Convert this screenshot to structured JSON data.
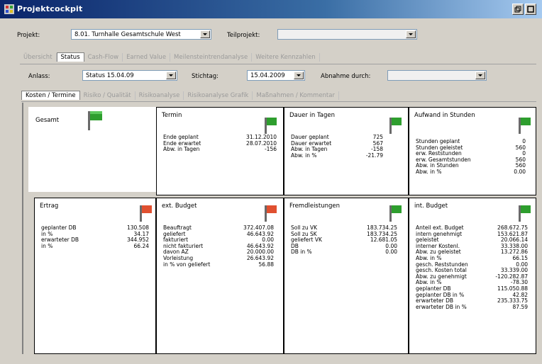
{
  "window": {
    "title": "Projektcockpit"
  },
  "header": {
    "projekt_label": "Projekt:",
    "projekt_value": "8.01. Turnhalle Gesamtschule West",
    "teilprojekt_label": "Teilprojekt:",
    "teilprojekt_value": ""
  },
  "main_tabs": [
    "Übersicht",
    "Status",
    "Cash-Flow",
    "Earned Value",
    "Meilensteintrendanalyse",
    "Weitere Kennzahlen"
  ],
  "filters": {
    "anlass_label": "Anlass:",
    "anlass_value": "Status 15.04.09",
    "stichtag_label": "Stichtag:",
    "stichtag_value": "15.04.2009",
    "abnahme_label": "Abnahme durch:",
    "abnahme_value": ""
  },
  "sub_tabs": [
    "Kosten / Termine",
    "Risiko / Qualität",
    "Risikoanalyse",
    "Risikoanalyse Grafik",
    "Maßnahmen / Kommentar"
  ],
  "colors": {
    "flag_green": "#2e9e2e",
    "flag_red": "#e05030",
    "titlebar": "#0a246a"
  },
  "cards": {
    "gesamt": {
      "title": "Gesamt",
      "flag": "green"
    },
    "termin": {
      "title": "Termin",
      "flag": "green",
      "rows": [
        {
          "label": "Ende geplant",
          "value": "31.12.2010"
        },
        {
          "label": "Ende erwartet",
          "value": "28.07.2010"
        },
        {
          "label": "Abw. in Tagen",
          "value": "-156"
        }
      ]
    },
    "dauer": {
      "title": "Dauer in Tagen",
      "flag": "green",
      "rows": [
        {
          "label": "Dauer geplant",
          "value": "725"
        },
        {
          "label": "Dauer erwartet",
          "value": "567"
        },
        {
          "label": "Abw. in Tagen",
          "value": "-158"
        },
        {
          "label": "Abw. in %",
          "value": "-21.79"
        }
      ]
    },
    "aufwand": {
      "title": "Aufwand in Stunden",
      "flag": "green",
      "rows": [
        {
          "label": "Stunden geplant",
          "value": "0"
        },
        {
          "label": "Stunden geleistet",
          "value": "560"
        },
        {
          "label": "erw. Reststunden",
          "value": "0"
        },
        {
          "label": "erw. Gesamtstunden",
          "value": "560"
        },
        {
          "label": "Abw. in Stunden",
          "value": "560"
        },
        {
          "label": "Abw. in %",
          "value": "0.00"
        }
      ]
    },
    "ertrag": {
      "title": "Ertrag",
      "flag": "red",
      "rows": [
        {
          "label": "geplanter DB",
          "value": "130.508"
        },
        {
          "label": "in %",
          "value": "34.17"
        },
        {
          "label": "erwarteter DB",
          "value": "344.952"
        },
        {
          "label": "in %",
          "value": "66.24"
        }
      ]
    },
    "extbudget": {
      "title": "ext. Budget",
      "flag": "red",
      "rows": [
        {
          "label": "Beauftragt",
          "value": "372.407.08"
        },
        {
          "label": "geliefert",
          "value": "46.643.92"
        },
        {
          "label": "fakturiert",
          "value": "0.00"
        },
        {
          "label": "nicht fakturiert",
          "value": "46.643.92"
        },
        {
          "label": "davon AZ",
          "value": "20.000.00"
        },
        {
          "label": "Vorleistung",
          "value": "26.643.92"
        },
        {
          "label": "in % von geliefert",
          "value": "56.88"
        }
      ]
    },
    "fremd": {
      "title": "Fremdleistungen",
      "flag": "green",
      "rows": [
        {
          "label": "Soll zu VK",
          "value": "183.734.25"
        },
        {
          "label": "Soll zu SK",
          "value": "183.734.25"
        },
        {
          "label": "geliefert VK",
          "value": "12.681.05"
        },
        {
          "label": "DB",
          "value": "0.00"
        },
        {
          "label": "DB in %",
          "value": "0.00"
        }
      ]
    },
    "intbudget": {
      "title": "int. Budget",
      "flag": "green",
      "rows": [
        {
          "label": "Anteil ext. Budget",
          "value": "268.672.75"
        },
        {
          "label": "intern genehmigt",
          "value": "153.621.87"
        },
        {
          "label": "geleistet",
          "value": "20.066.14"
        },
        {
          "label": "interner Kostenl.",
          "value": "33.338.00"
        },
        {
          "label": "Abw. zu geleistet",
          "value": "13.272.86"
        },
        {
          "label": "Abw. in %",
          "value": "66.15"
        },
        {
          "label": "gesch. Reststunden",
          "value": "0.00"
        },
        {
          "label": "gesch. Kosten total",
          "value": "33.339.00"
        },
        {
          "label": "Abw. zu genehmigt",
          "value": "-120.282.87"
        },
        {
          "label": "Abw. in %",
          "value": "-78.30"
        },
        {
          "label": "geplanter DB",
          "value": "115.050.88"
        },
        {
          "label": "geplanter DB in %",
          "value": "42.82"
        },
        {
          "label": "erwarteter DB",
          "value": "235.333.75"
        },
        {
          "label": "erwarteter DB in %",
          "value": "87.59"
        }
      ]
    }
  }
}
